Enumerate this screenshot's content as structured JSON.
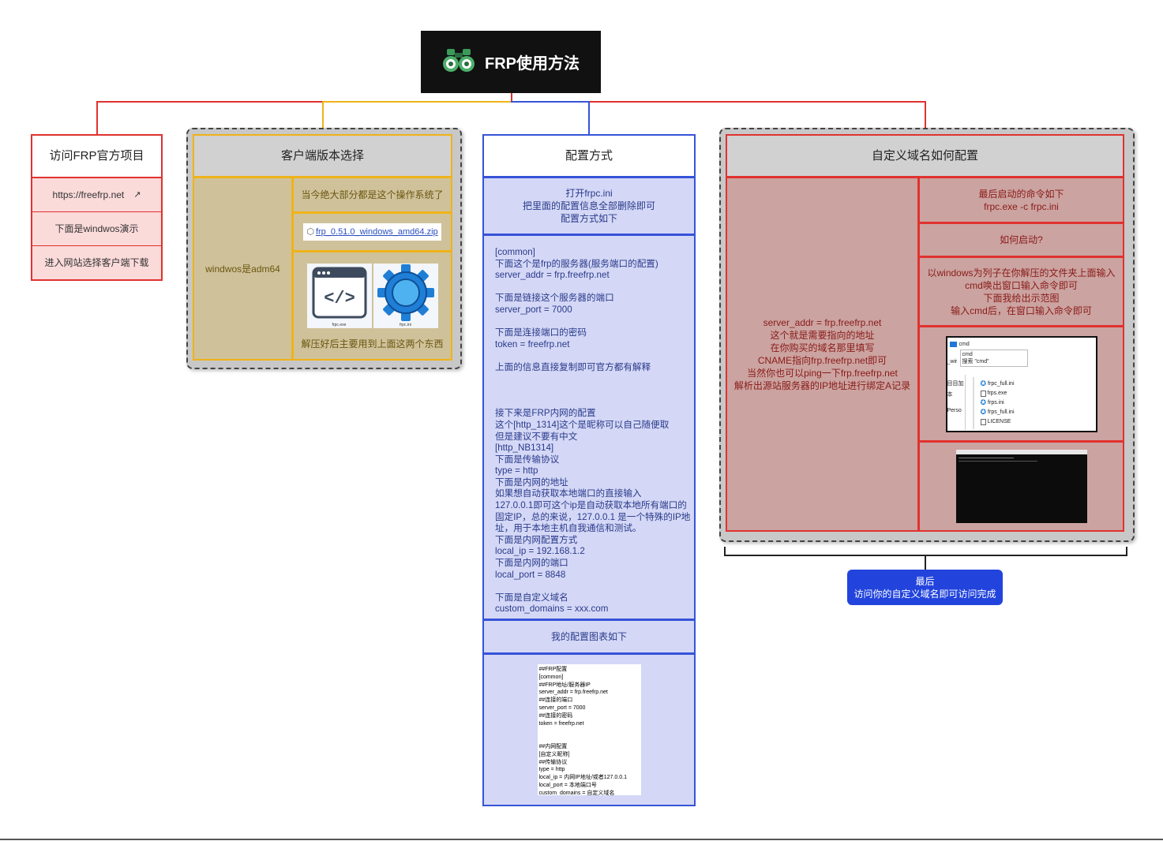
{
  "root": {
    "title": "FRP使用方法",
    "icon": "binoculars-icon"
  },
  "col1": {
    "head": "访问FRP官方项目",
    "link": "https://freefrp.net",
    "item2": "下面是windwos演示",
    "item3": "进入网站选择客户端下载"
  },
  "col2": {
    "head": "客户端版本选择",
    "left": "windwos是adm64",
    "r1": "当今绝大部分都是这个操作系统了",
    "file": "frp_0.51.0_windows_amd64.zip",
    "icon1_label": "frpc.exe",
    "icon2_label": "frpc.ini",
    "r3": "解压好后主要用到上面这两个东西"
  },
  "col3": {
    "head": "配置方式",
    "intro": "打开frpc.ini\n把里面的配置信息全部删除即可\n配置方式如下",
    "body": "[common]\n下面这个是frp的服务器(服务端口的配置)\nserver_addr = frp.freefrp.net\n\n下面是链接这个服务器的端口\nserver_port = 7000\n\n下面是连接端口的密码\ntoken = freefrp.net\n\n上面的信息直接复制即可官方都有解释\n\n\n\n接下来是FRP内网的配置\n这个[http_1314]这个是昵称可以自己随便取\n但是建议不要有中文\n[http_NB1314]\n下面是传输协议\ntype = http\n下面是内网的地址\n如果想自动获取本地端口的直接输入\n127.0.0.1即可这个ip是自动获取本地所有端口的\n固定IP，总的来说，127.0.0.1 是一个特殊的IP地\n址，用于本地主机自我通信和测试。\n下面是内网配置方式\nlocal_ip = 192.168.1.2\n下面是内网的端口\nlocal_port = 8848\n\n下面是自定义域名\ncustom_domains = xxx.com",
    "chart_head": "我的配置图表如下",
    "snippet": "##FRP配置\n[common]\n##FRP地址/服务器IP\nserver_addr = frp.freefrp.net\n##连接的端口\nserver_port = 7000\n##连接的密码\ntoken = freefrp.net\n\n\n##内网配置\n[自定义昵称]\n##传输协议\ntype = http\nlocal_ip = 内网IP地址/或者127.0.0.1\nlocal_port = 本地端口号\ncustom_domains = 自定义域名"
  },
  "col4": {
    "head": "自定义域名如何配置",
    "left": "server_addr = frp.freefrp.net\n这个就是需要指向的地址\n在你购买的域名那里填写\nCNAME指向frp.freefrp.net即可\n当然你也可以ping一下frp.freefrp.net\n解析出源站服务器的IP地址进行绑定A记录",
    "r1": "最后启动的命令如下\nfrpc.exe -c frpc.ini",
    "r2": "如何启动?",
    "r3": "以windows为列子在你解压的文件夹上面输入\ncmd唤出窗口输入命令即可\n下面我给出示范图\n输入cmd后，在窗口输入命令即可",
    "ss": {
      "addr": "cmd",
      "dropdown1": "cmd",
      "dropdown2": "搜索 \"cmd\"",
      "side1": "_wir",
      "side2": "目目加",
      "side3": "本",
      "side4": "Perso",
      "files": [
        "frpc_full.ini",
        "frps.exe",
        "frps.ini",
        "frps_full.ini",
        "LICENSE"
      ]
    }
  },
  "final": {
    "line1": "最后",
    "line2": "访问你的自定义域名即可访问完成"
  },
  "colors": {
    "red": "#e0322f",
    "yellow": "#efb319",
    "blue": "#3653d8",
    "dark": "#111111",
    "final": "#2244dd"
  }
}
